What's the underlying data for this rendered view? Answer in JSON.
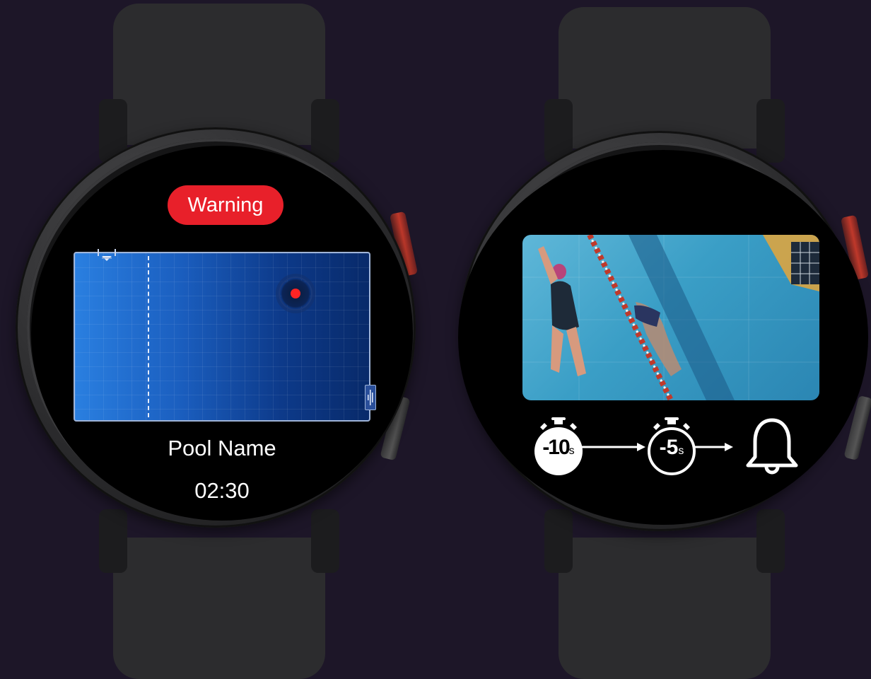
{
  "left_watch": {
    "warning_label": "Warning",
    "pool_name": "Pool Name",
    "timer": "02:30",
    "colors": {
      "warning": "#e8202a",
      "pool_light": "#2a7fe0",
      "pool_dark": "#082a6a",
      "swimmer_marker": "#ff2424"
    },
    "icons": [
      "ladder-icon",
      "ladder-icon",
      "swimmer-position-marker"
    ]
  },
  "right_watch": {
    "video": {
      "icon": "swimming-pool-video-feed"
    },
    "countdown": {
      "steps": [
        {
          "label": "-10",
          "unit": "s",
          "icon": "stopwatch-icon"
        },
        {
          "label": "-5",
          "unit": "s",
          "icon": "stopwatch-icon"
        },
        {
          "icon": "bell-icon"
        }
      ]
    }
  }
}
